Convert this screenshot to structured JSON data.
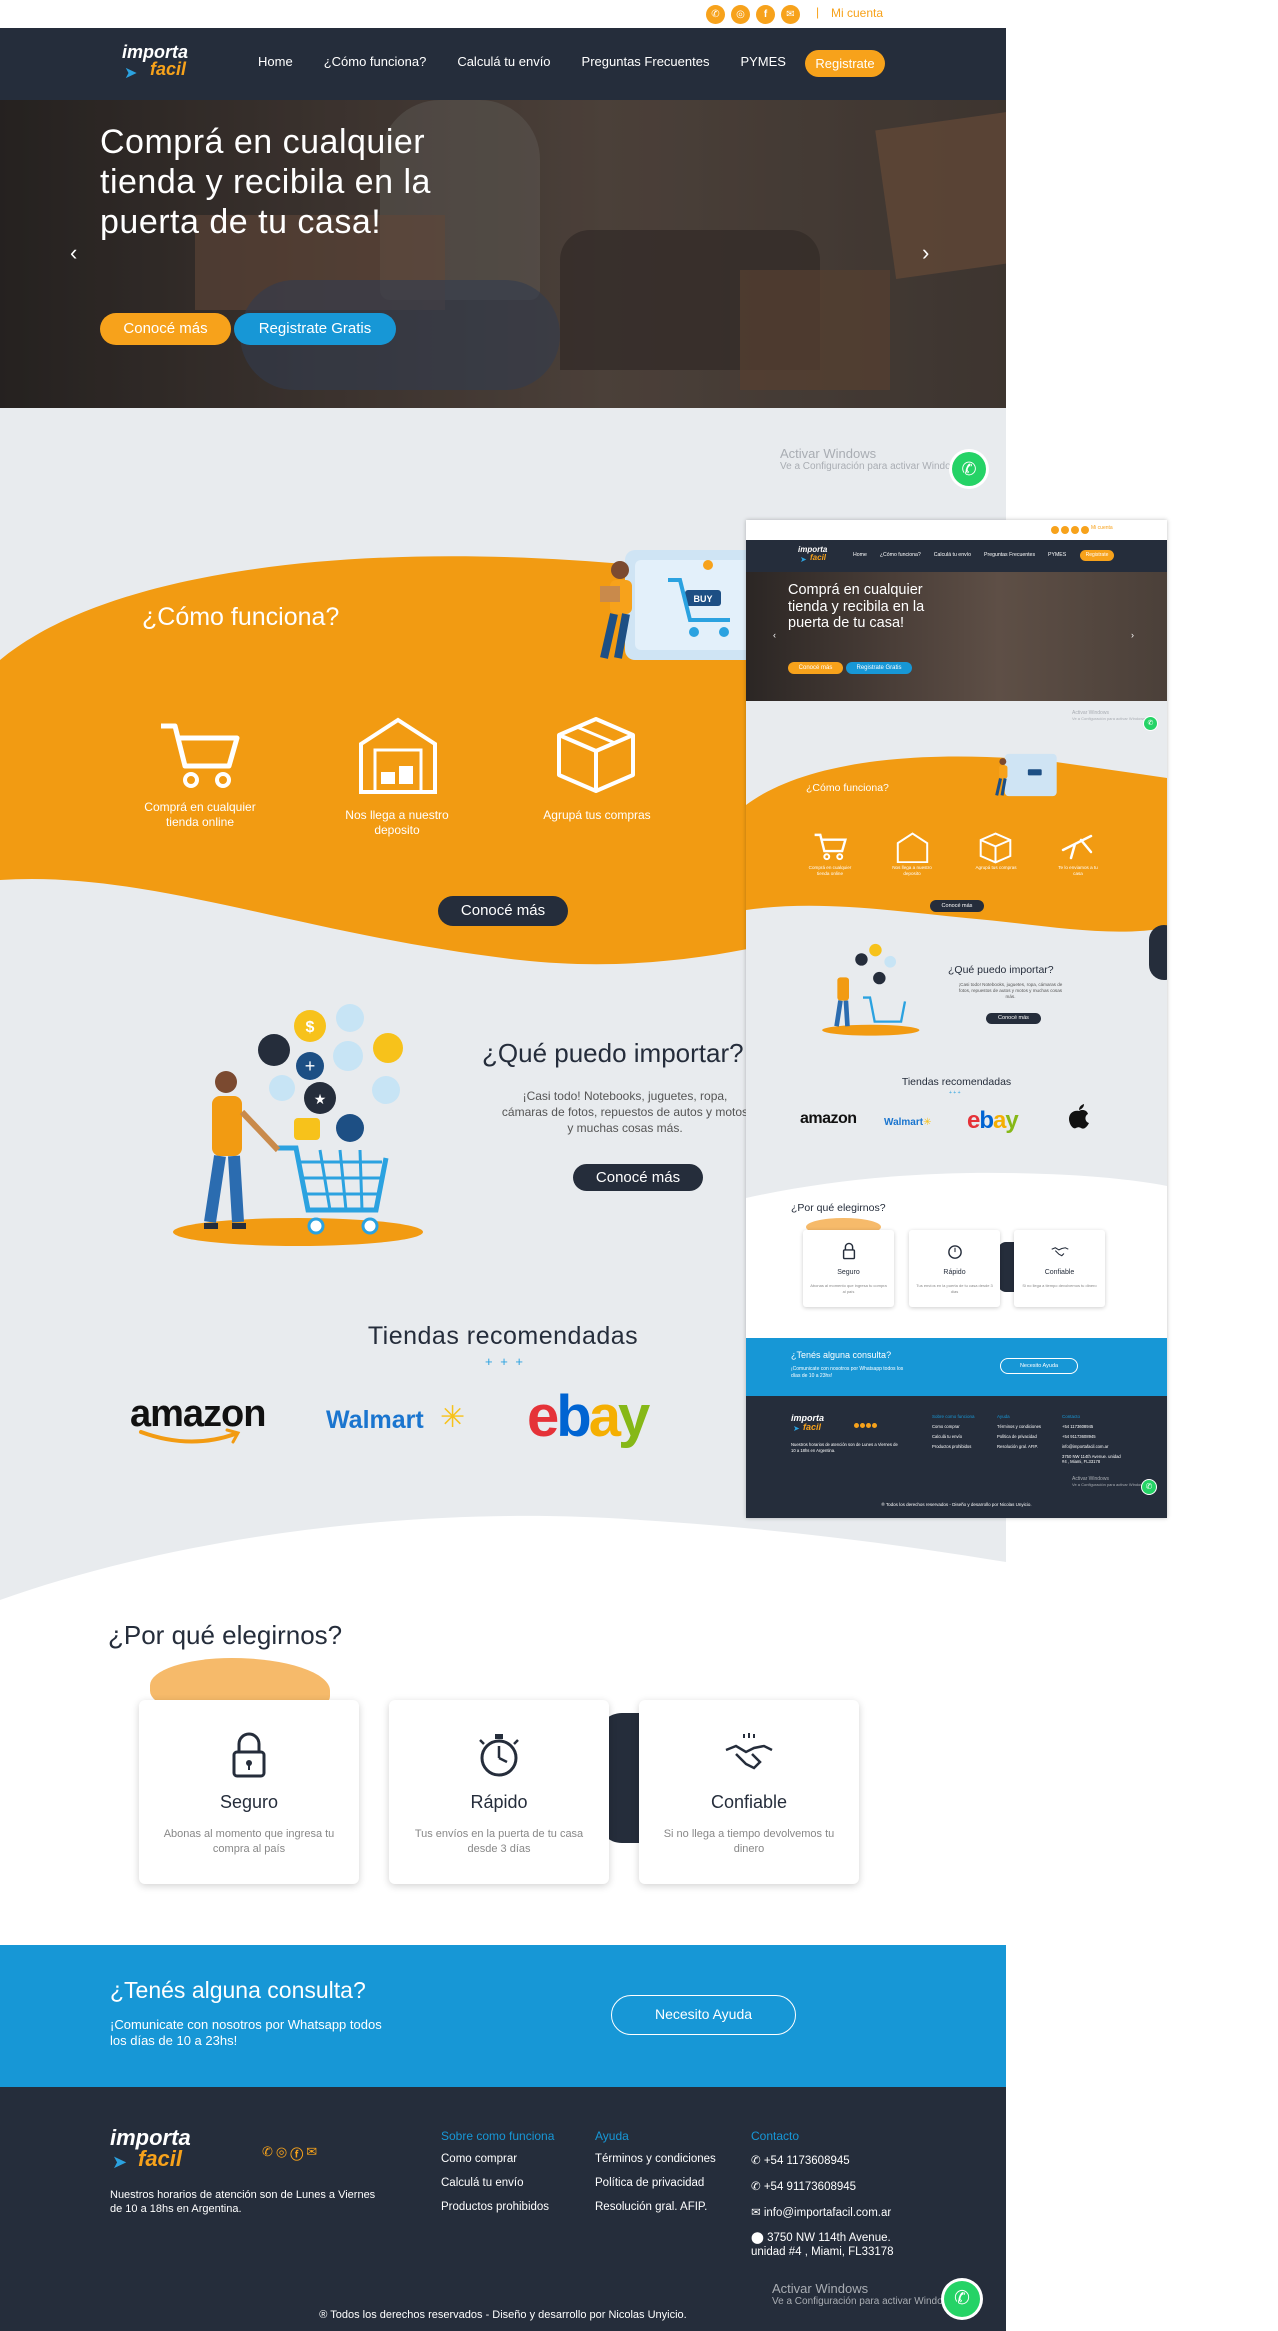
{
  "topbar": {
    "social_icons": [
      "whatsapp-icon",
      "instagram-icon",
      "facebook-icon",
      "mail-icon"
    ],
    "separator": "|",
    "account_link": "Mi cuenta"
  },
  "nav": {
    "logo_line1": "importa",
    "logo_line2": "facil",
    "links": [
      "Home",
      "¿Cómo funciona?",
      "Calculá tu envío",
      "Preguntas Frecuentes",
      "PYMES"
    ],
    "cta": "Registrate"
  },
  "hero": {
    "title": "Comprá en cualquier tienda y recibila en la puerta de tu casa!",
    "btn_more": "Conocé más",
    "btn_register": "Registrate Gratis",
    "arrow_prev": "‹",
    "arrow_next": "›"
  },
  "windows_notice": {
    "line1": "Activar Windows",
    "line2": "Ve a Configuración para activar Windows."
  },
  "how": {
    "title": "¿Cómo funciona?",
    "illus_label": "BUY",
    "items": [
      {
        "icon": "cart-icon",
        "label": "Comprá en cualquier tienda online"
      },
      {
        "icon": "warehouse-icon",
        "label": "Nos llega a nuestro deposito"
      },
      {
        "icon": "box-icon",
        "label": "Agrupá tus compras"
      },
      {
        "icon": "airplane-icon",
        "label": "Te lo enviamos a tu casa"
      }
    ],
    "button": "Conocé más"
  },
  "import": {
    "title": "¿Qué puedo importar?",
    "description": "¡Casi todo! Notebooks, juguetes, ropa, cámaras de fotos, repuestos de autos y motos y muchas cosas más.",
    "button": "Conocé más"
  },
  "stores": {
    "title": "Tiendas recomendadas",
    "dots": "+ + +",
    "amazon": "amazon",
    "walmart": "Walmart",
    "walmart_spark": "✳",
    "ebay": [
      "e",
      "b",
      "a",
      "y"
    ],
    "apple": ""
  },
  "why": {
    "title": "¿Por qué elegirnos?",
    "cards": [
      {
        "icon": "padlock-icon",
        "title": "Seguro",
        "desc": "Abonas al momento que ingresa tu compra al país"
      },
      {
        "icon": "stopwatch-icon",
        "title": "Rápido",
        "desc": "Tus envíos en la puerta de tu casa desde 3 días"
      },
      {
        "icon": "handshake-icon",
        "title": "Confiable",
        "desc": "Si no llega a tiempo devolvemos tu dinero"
      }
    ]
  },
  "consult": {
    "title": "¿Tenés alguna consulta?",
    "subtitle": "¡Comunicate con nosotros por Whatsapp todos los días de 10 a 23hs!",
    "button": "Necesito Ayuda"
  },
  "footer": {
    "hours": "Nuestros horarios de atención son de Lunes a Viernes de 10 a 18hs en Argentina.",
    "col1": {
      "heading": "Sobre como funciona",
      "links": [
        "Como comprar",
        "Calculá tu envío",
        "Productos prohibidos"
      ]
    },
    "col2": {
      "heading": "Ayuda",
      "links": [
        "Términos y condiciones",
        "Política de privacidad",
        "Resolución gral. AFIP."
      ]
    },
    "col3": {
      "heading": "Contacto",
      "links": [
        "+54 1173608945",
        "+54 91173608945",
        "info@importafacil.com.ar",
        "3750 NW 114th Avenue. unidad #4 , Miami, FL33178"
      ]
    },
    "copyright": "® Todos los derechos reservados - Diseño y desarrollo por Nicolas Unyicio."
  },
  "colors": {
    "orange": "#f7a21b",
    "navy": "#252d3b",
    "blue": "#1797d6",
    "grey": "#e8ebee",
    "whatsapp": "#25d366"
  }
}
